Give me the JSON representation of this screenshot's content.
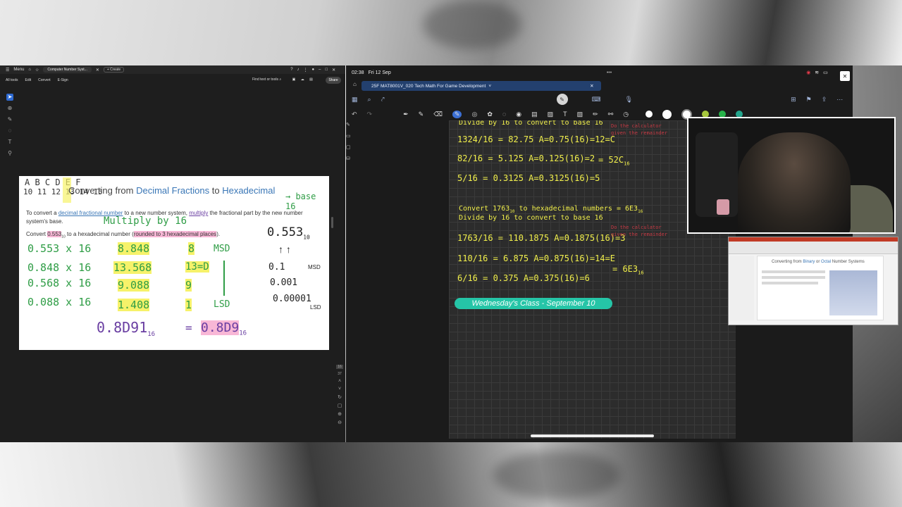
{
  "acrobat": {
    "menu_label": "Menu",
    "tab_title": "Computer Number Syst...",
    "create_label": "+ Create",
    "toolbar": [
      "All tools",
      "Edit",
      "Convert",
      "E-Sign"
    ],
    "find_label": "Find text or tools",
    "share_label": "Share",
    "page_number": "16",
    "page_total": "37",
    "page": {
      "header_letters": "A B C D E F",
      "header_numbers": "10 11 12 13 14 15",
      "title_prefix": "Converting from ",
      "title_mid": "Decimal Fractions",
      "title_to": " to ",
      "title_end": "Hexadecimal",
      "base_note": "base 16",
      "para1_a": "To convert a ",
      "para1_b": "decimal fractional number",
      "para1_c": " to a new number system, ",
      "para1_d": "multiply",
      "para1_e": " the fractional part by the new number system's base.",
      "multiply_note": "Multiply by 16",
      "para2_a": "Convert ",
      "para2_b": "0.553",
      "para2_sub": "10",
      "para2_c": " to a hexadecimal number (",
      "para2_d": "rounded to 3 hexadecimal places",
      "para2_e": ").",
      "rows": [
        {
          "expr": "0.553 x 16",
          "result": "8.848",
          "digit": "8"
        },
        {
          "expr": "0.848 x 16",
          "result": "13.568",
          "digit": "13=D"
        },
        {
          "expr": "0.568 x 16",
          "result": "9.088",
          "digit": "9"
        },
        {
          "expr": "0.088 x 16",
          "result": "1.408",
          "digit": "1"
        }
      ],
      "msd": "MSD",
      "lsd": "LSD",
      "right_value": "0.553",
      "right_sub": "10",
      "right_lines": [
        "0.1",
        "0.001",
        "0.00001"
      ],
      "right_msd": "MSD",
      "right_lsd": "LSD",
      "answer_a": "0.8D91",
      "answer_sub_a": "16",
      "answer_eq": "=",
      "answer_b": "0.8D9",
      "answer_sub_b": "16"
    }
  },
  "ipad": {
    "time": "02:38",
    "date": "Fri 12 Sep",
    "doc_title": "25F MAT8001V_020 Tech Math For Game Development",
    "notes": {
      "line_top": "Divide by 16 to convert to base 16",
      "a1": "1324/16 = 82.75   A=0.75(16)=12=C",
      "a2": "82/16 = 5.125   A=0.125(16)=2",
      "a2_result": "= 52C",
      "a2_sub": "16",
      "a3": "5/16 = 0.3125   A=0.3125(16)=5",
      "b_head": "Convert 1763",
      "b_head_sub": "10",
      "b_head_end": " to hexadecimal numbers = 6E3",
      "b_head_sub2": "16",
      "b_line2": "Divide by 16 to convert to base 16",
      "b1": "1763/16 = 110.1875   A=0.1875(16)=3",
      "b2": "110/16 = 6.875   A=0.875(16)=14=E",
      "b2_result": "= 6E3",
      "b2_sub": "16",
      "b3": "6/16 = 0.375   A=0.375(16)=6",
      "red_note1": "Do the calculator",
      "red_note2": "given the remainder",
      "red_note3": "Do the calculator",
      "red_note4": "given the remainder",
      "banner": "Wednesday's Class - September 10"
    }
  },
  "ppt": {
    "slide_title_a": "Converting from ",
    "slide_title_b": "Binary",
    "slide_title_c": " or ",
    "slide_title_d": "Octal",
    "slide_title_e": " Number Systems"
  },
  "colors": {
    "acrobat_bg": "#1e1e1e",
    "ipad_bg": "#1b1b1b",
    "note_yellow": "#f1ef4b",
    "banner_teal": "#25c5a7",
    "hand_green": "#2f9d46",
    "hand_purple": "#6a3fa2"
  }
}
